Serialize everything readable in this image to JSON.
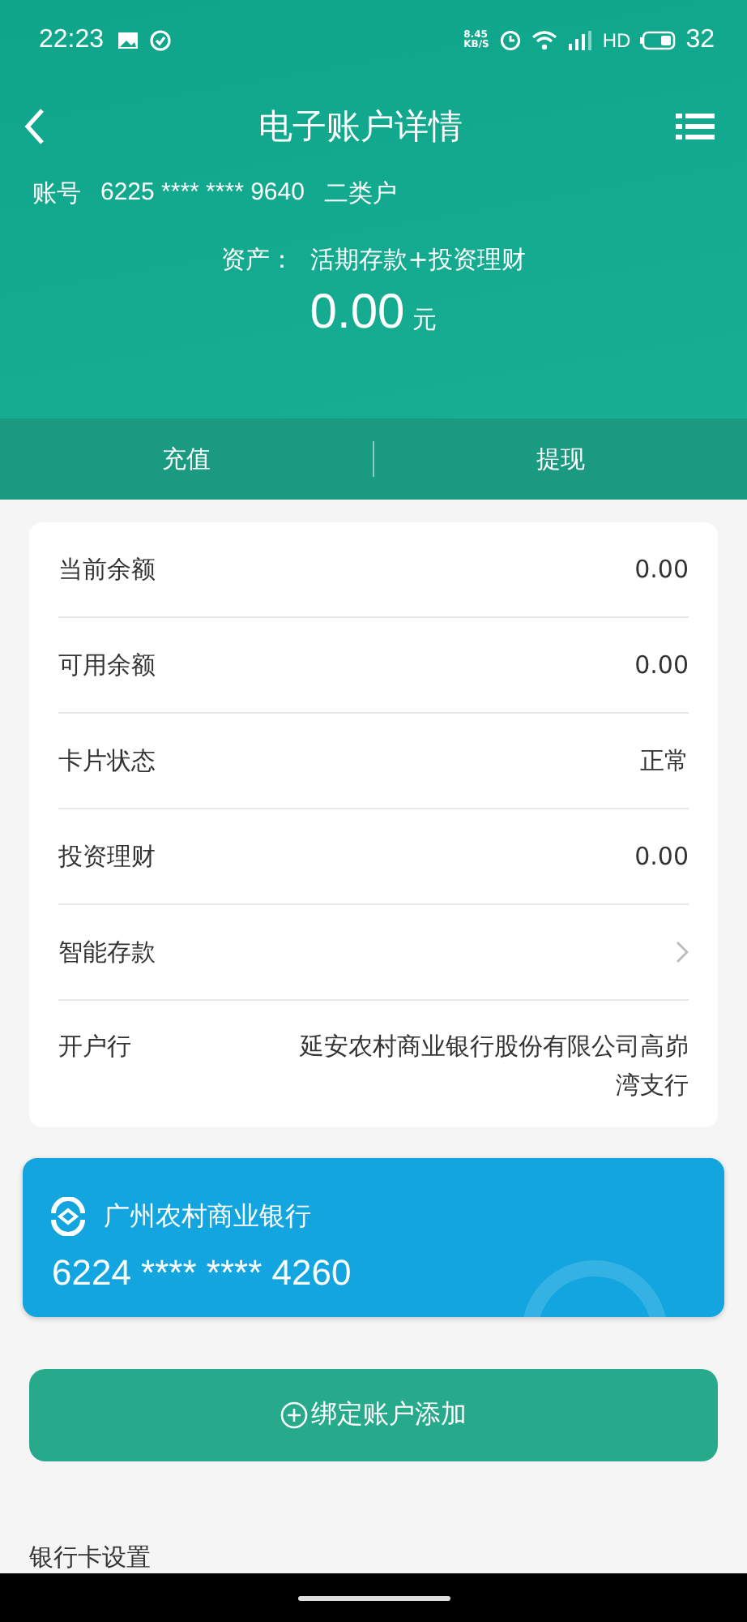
{
  "status_bar": {
    "time": "22:23",
    "speed": "8.45\nKB/S",
    "network": "HD",
    "battery": "32"
  },
  "header": {
    "title": "电子账户详情",
    "account_label": "账号",
    "account_number": "6225 **** **** 9640",
    "account_type": "二类户",
    "assets_label": "资产：",
    "assets_desc": "活期存款+投资理财",
    "amount": "0.00",
    "unit": "元"
  },
  "actions": [
    "充值",
    "提现"
  ],
  "details": [
    {
      "kind": "value",
      "label": "当前余额",
      "value": "0.00"
    },
    {
      "kind": "value",
      "label": "可用余额",
      "value": "0.00"
    },
    {
      "kind": "value",
      "label": "卡片状态",
      "value": "正常"
    },
    {
      "kind": "value",
      "label": "投资理财",
      "value": "0.00"
    },
    {
      "kind": "link",
      "label": "智能存款"
    },
    {
      "kind": "value",
      "label": "开户行",
      "value": "延安农村商业银行股份有限公司高峁湾支行"
    }
  ],
  "bound_card": {
    "bank": "广州农村商业银行",
    "number": "6224 **** **** 4260"
  },
  "add_button": "绑定账户添加",
  "footer_text": "银行卡设置"
}
